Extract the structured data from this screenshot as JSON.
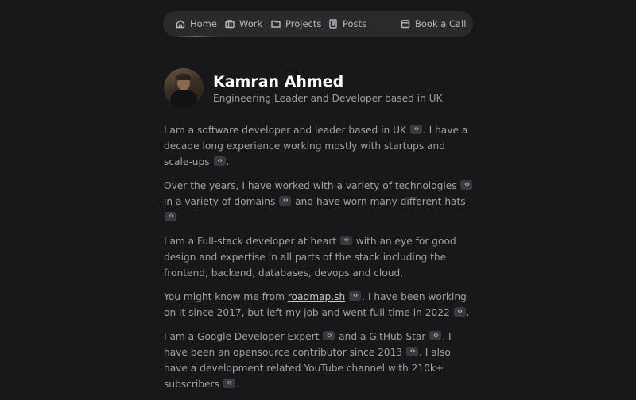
{
  "nav": {
    "items": [
      {
        "label": "Home",
        "icon": "home-icon",
        "active": true
      },
      {
        "label": "Work",
        "icon": "briefcase-icon"
      },
      {
        "label": "Projects",
        "icon": "folder-icon"
      },
      {
        "label": "Posts",
        "icon": "document-icon"
      }
    ],
    "cta": {
      "label": "Book a Call",
      "icon": "calendar-icon"
    }
  },
  "profile": {
    "name": "Kamran Ahmed",
    "tagline": "Engineering Leader and Developer based in UK"
  },
  "bio": {
    "p1": {
      "a": "I am a software developer and leader based in UK",
      "b": ". I have a decade long experience working mostly with startups and scale-ups",
      "c": "."
    },
    "p2": {
      "a": "Over the years, I have worked with a variety of technologies",
      "b": " in a variety of domains",
      "c": " and have worn many different hats"
    },
    "p3": {
      "a": "I am a Full-stack developer at heart",
      "b": " with an eye for good design and expertise in all parts of the stack including the frontend, backend, databases, devops and cloud."
    },
    "p4": {
      "a": "You might know me from ",
      "link": "roadmap.sh",
      "b": ". I have been working on it since 2017, but left my job and went full-time in 2022",
      "c": "."
    },
    "p5": {
      "a": "I am a Google Developer Expert",
      "b": " and a GitHub Star",
      "c": ". I have been an opensource contributor since 2013",
      "d": ". I also have a development related YouTube channel with 210k+ subscribers",
      "e": "."
    }
  }
}
